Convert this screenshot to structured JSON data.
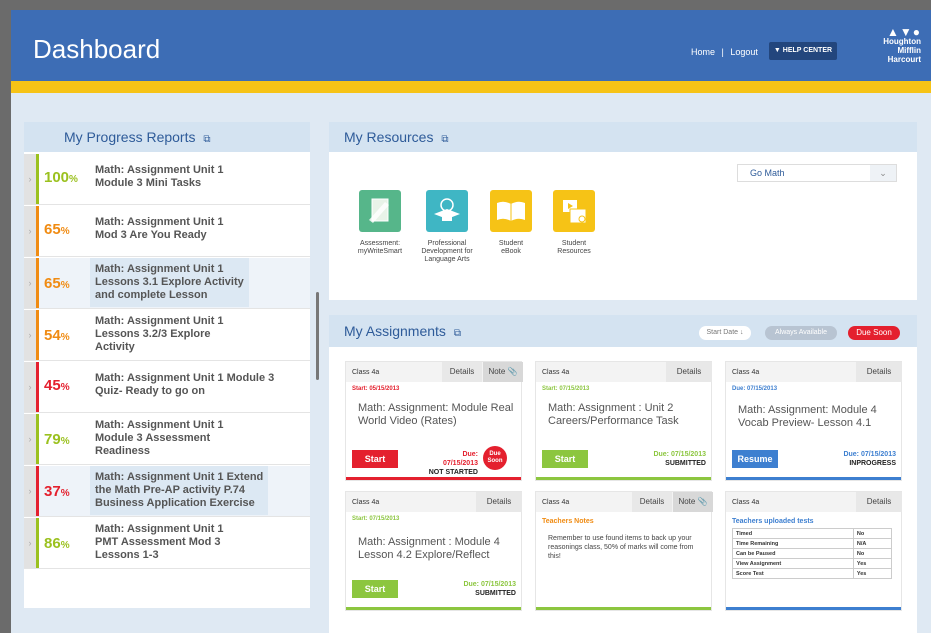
{
  "header": {
    "title": "Dashboard",
    "home": "Home",
    "sep": "|",
    "logout": "Logout",
    "help": "▼ HELP CENTER",
    "logo_line1": "Houghton",
    "logo_line2": "Mifflin",
    "logo_line3": "Harcourt"
  },
  "progress": {
    "title": "My Progress Reports",
    "items": [
      {
        "pct": "100",
        "text": "Math: Assignment Unit 1\nModule 3 Mini Tasks",
        "color": "#9bc11f"
      },
      {
        "pct": "65",
        "text": "Math: Assignment Unit 1\nMod 3 Are You Ready",
        "color": "#f08b12"
      },
      {
        "pct": "65",
        "text": "Math: Assignment Unit 1\nLessons 3.1 Explore Activity\nand  complete Lesson",
        "color": "#f08b12"
      },
      {
        "pct": "54",
        "text": "Math: Assignment Unit 1\nLessons 3.2/3 Explore\nActivity",
        "color": "#f08b12"
      },
      {
        "pct": "45",
        "text": "Math: Assignment Unit 1 Module 3\nQuiz- Ready to go on",
        "color": "#e4202e"
      },
      {
        "pct": "79",
        "text": "Math: Assignment Unit 1\nModule 3 Assessment\nReadiness",
        "color": "#9bc11f"
      },
      {
        "pct": "37",
        "text": "Math: Assignment Unit 1 Extend\nthe Math Pre-AP activity  P.74\nBusiness Application  Exercise",
        "color": "#e4202e"
      },
      {
        "pct": "86",
        "text": "Math: Assignment Unit 1\nPMT Assessment  Mod 3\nLessons 1-3",
        "color": "#9bc11f"
      }
    ]
  },
  "resources": {
    "title": "My Resources",
    "select": "Go Math",
    "items": [
      {
        "label": "Assessment:\nmyWriteSmart",
        "color": "#56b68a"
      },
      {
        "label": "Professional\nDevelopment for\nLanguage Arts",
        "color": "#3fb6c4"
      },
      {
        "label": "Student\neBook",
        "color": "#f6c316"
      },
      {
        "label": "Student\nResources",
        "color": "#f6c316"
      }
    ]
  },
  "assignments": {
    "title": "My Assignments",
    "start_date": "Start Date ↓",
    "always": "Always Available",
    "due_soon": "Due Soon",
    "cards": [
      {
        "cls": "Class 4a",
        "details": "Details",
        "note": "Note",
        "start": "Start: 05/15/2013",
        "title": "Math: Assignment: Module Real World Video (Rates)",
        "button": "Start",
        "due": "Due: 07/15/2013",
        "status": "NOT STARTED",
        "soon": "Due\nSoon"
      },
      {
        "cls": "Class 4a",
        "details": "Details",
        "start": "Start: 07/15/2013",
        "title": "Math: Assignment : Unit 2 Careers/Performance Task",
        "button": "Start",
        "due": "Due: 07/15/2013",
        "status": "SUBMITTED"
      },
      {
        "cls": "Class 4a",
        "details": "Details",
        "start": "Due: 07/15/2013",
        "title": "Math: Assignment: Module 4 Vocab Preview- Lesson 4.1",
        "button": "Resume",
        "due": "Due: 07/15/2013",
        "status": "INPROGRESS"
      },
      {
        "cls": "Class 4a",
        "details": "Details",
        "start": "Start: 07/15/2013",
        "title": "Math: Assignment : Module 4 Lesson 4.2 Explore/Reflect",
        "button": "Start",
        "due": "Due: 07/15/2013",
        "status": "SUBMITTED"
      },
      {
        "cls": "Class 4a",
        "details": "Details",
        "note": "Note",
        "notes_title": "Teachers Notes",
        "notes_text": "Remember to use found items to back up your reasonings class, 50% of marks will come from this!"
      },
      {
        "cls": "Class 4a",
        "details": "Details",
        "tests_title": "Teachers uploaded tests",
        "rows": [
          [
            "Timed",
            "No"
          ],
          [
            "Time Remaining",
            "N/A"
          ],
          [
            "Can be Paused",
            "No"
          ],
          [
            "View Assignment",
            "Yes"
          ],
          [
            "Score Test",
            "Yes"
          ]
        ]
      }
    ]
  },
  "colors": {
    "red": "#e4202e",
    "green": "#8cc63f",
    "blue": "#3d7fd0",
    "header": "#3d6db5",
    "stripe": "#f6c316"
  }
}
